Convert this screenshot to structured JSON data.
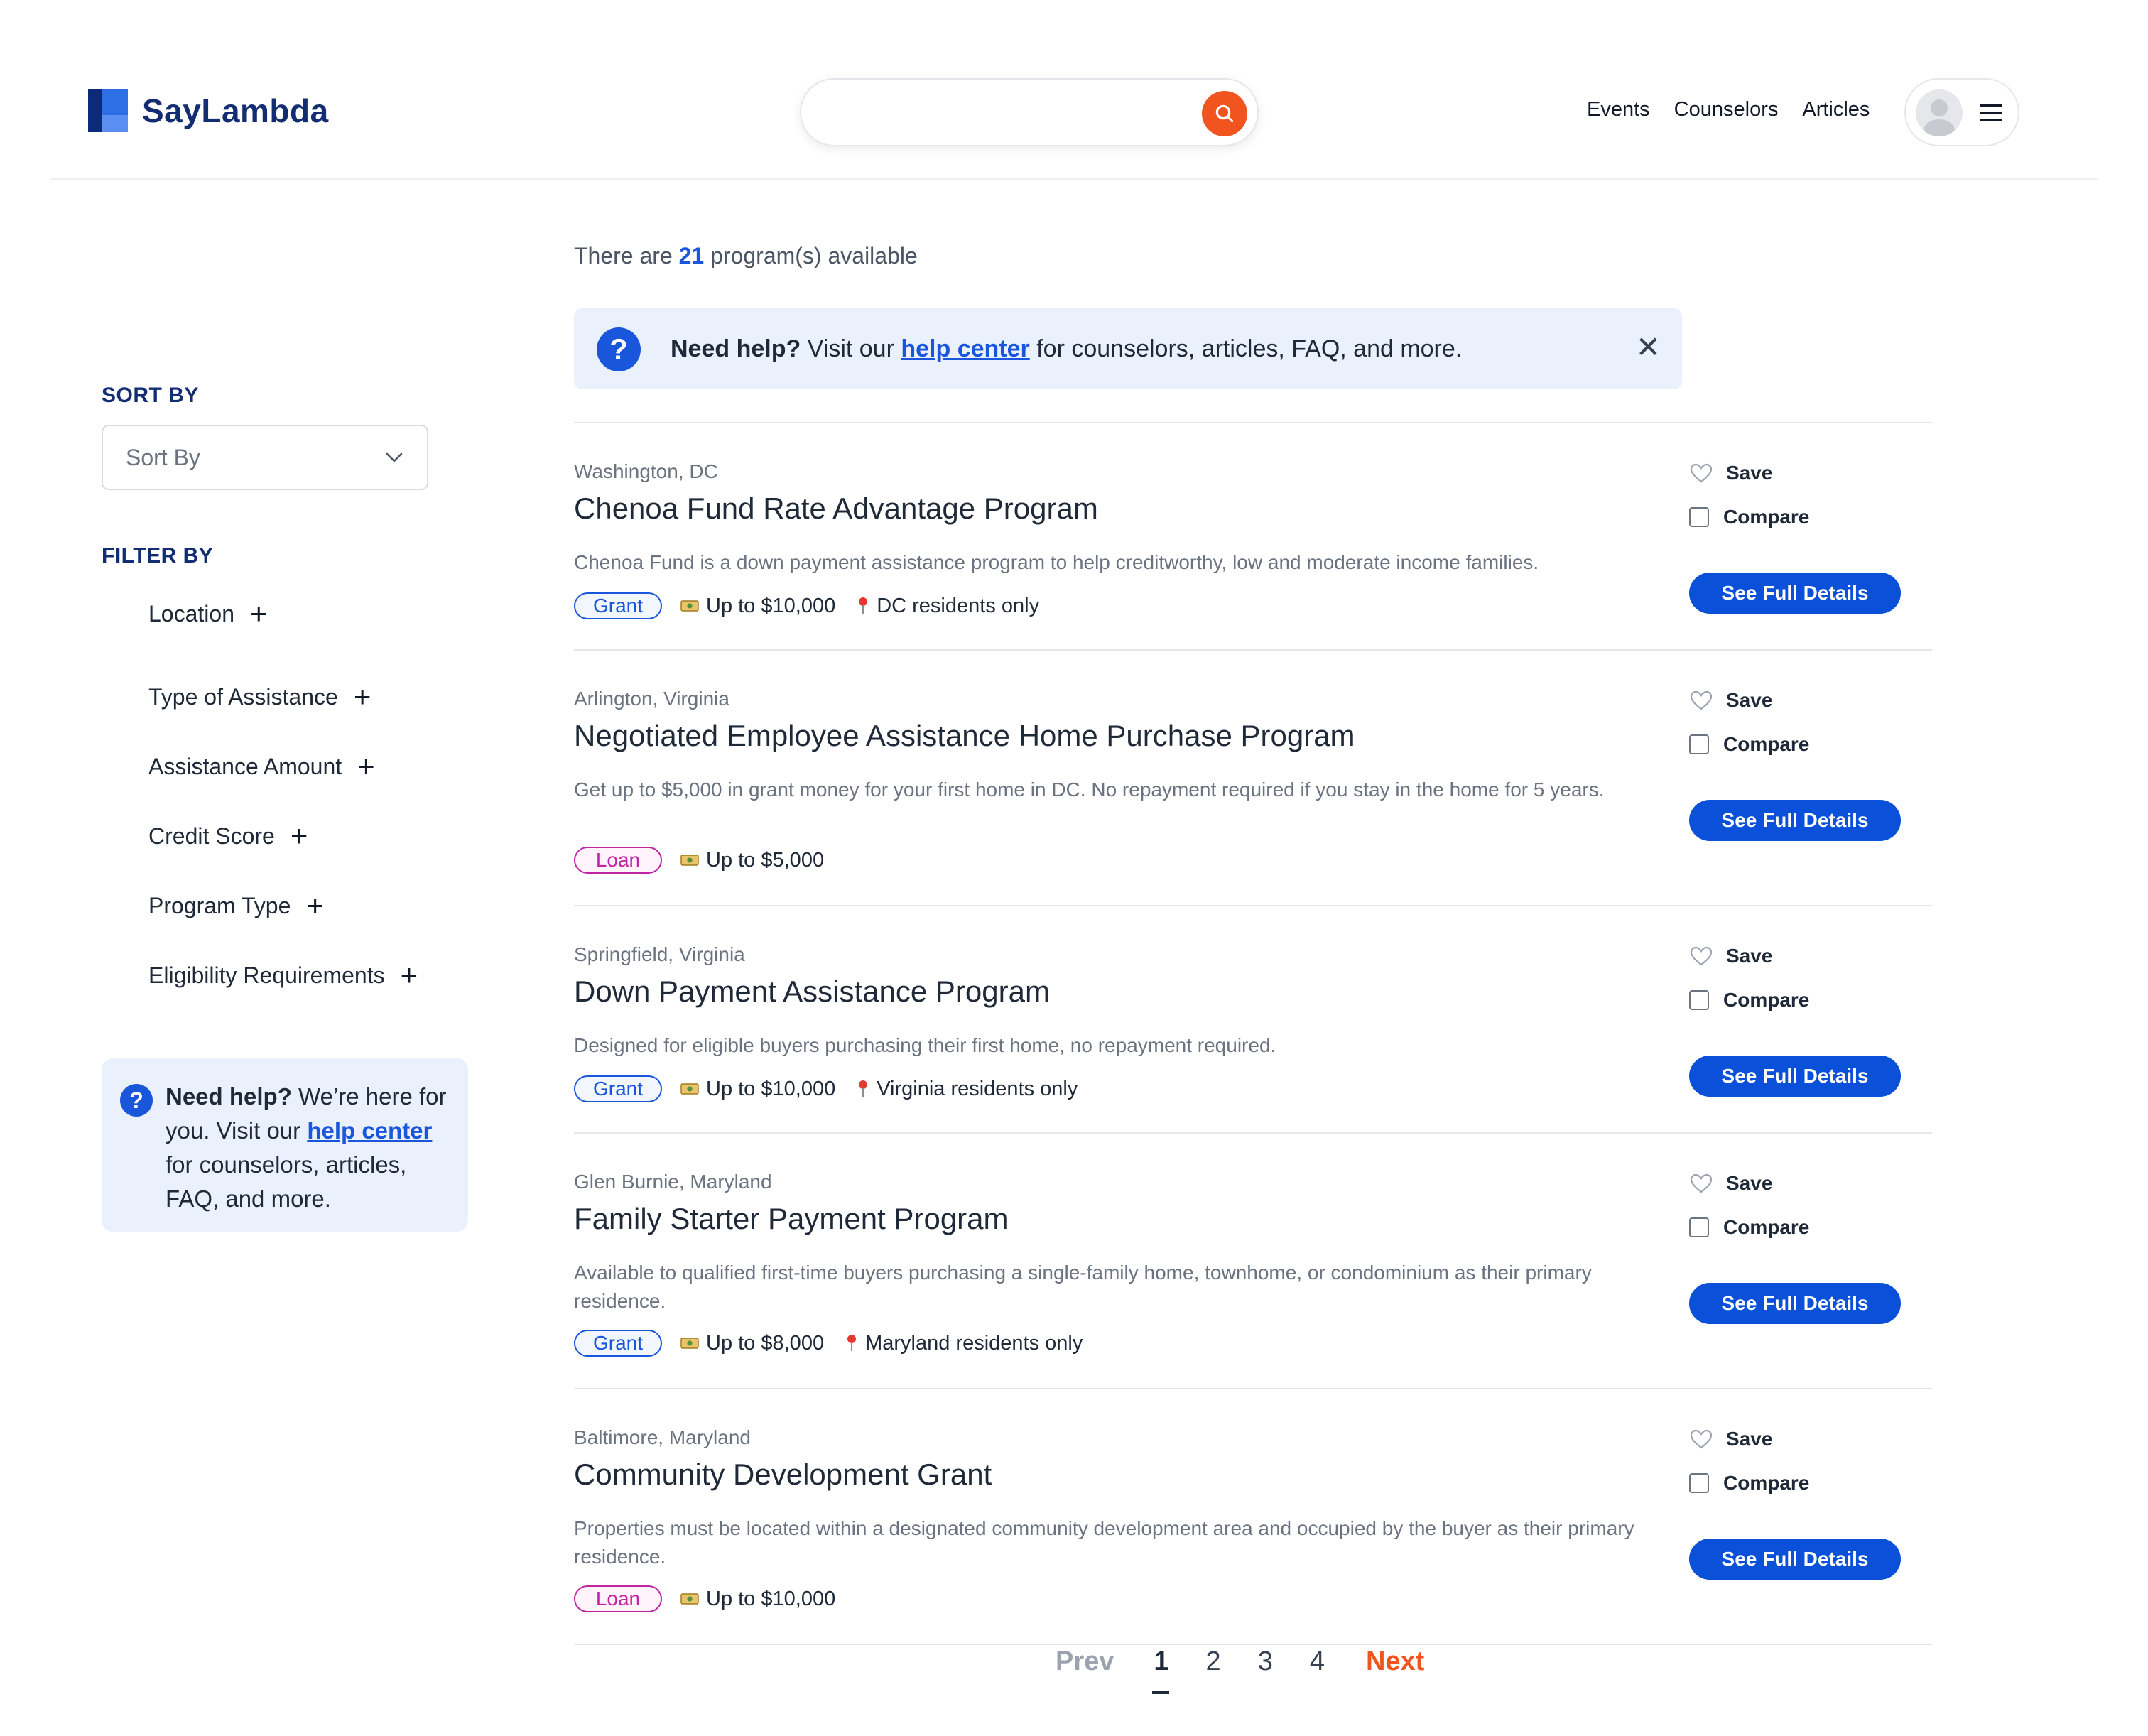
{
  "header": {
    "logo_text": "SayLambda",
    "search": {
      "value": "",
      "placeholder": ""
    },
    "nav": [
      "Events",
      "Counselors",
      "Articles"
    ]
  },
  "summary": {
    "prefix": "There are",
    "count": "21",
    "suffix": "program(s) available"
  },
  "banner": {
    "bold": "Need help?",
    "text_before_link": "Visit our",
    "link": "help center",
    "text_after_link": "for counselors, articles, FAQ, and more."
  },
  "sidebar": {
    "sort_title": "SORT BY",
    "sort_value": "Sort By",
    "filter_title": "FILTER BY",
    "filters": [
      "Location",
      "Type of Assistance",
      "Assistance Amount",
      "Credit Score",
      "Program Type",
      "Eligibility Requirements"
    ],
    "help": {
      "bold": "Need help?",
      "text_before_link": "We’re here for you. Visit our",
      "link": "help center",
      "text_after_link": "for counselors, articles, FAQ, and more."
    }
  },
  "actions": {
    "save": "Save",
    "compare": "Compare",
    "details": "See Full Details"
  },
  "programs": [
    {
      "location": "Washington, DC",
      "title": "Chenoa Fund Rate Advantage Program",
      "description": "Chenoa Fund is a down payment assistance program to help creditworthy, low and moderate income families.",
      "type": "Grant",
      "amount": "Up to $10,000",
      "residency": "DC residents only"
    },
    {
      "location": "Arlington, Virginia",
      "title": "Negotiated Employee Assistance Home Purchase Program",
      "description": "Get up to $5,000 in grant money for your first home in DC. No repayment required if you stay in the home for 5 years.",
      "type": "Loan",
      "amount": "Up to $5,000",
      "residency": ""
    },
    {
      "location": "Springfield, Virginia",
      "title": "Down Payment Assistance Program",
      "description": "Designed for eligible buyers purchasing their first home, no repayment required.",
      "type": "Grant",
      "amount": "Up to $10,000",
      "residency": "Virginia residents only"
    },
    {
      "location": "Glen Burnie, Maryland",
      "title": "Family Starter Payment Program",
      "description": "Available to qualified first-time buyers purchasing a single-family home, townhome, or condominium as their primary residence.",
      "type": "Grant",
      "amount": "Up to $8,000",
      "residency": "Maryland residents only"
    },
    {
      "location": "Baltimore, Maryland",
      "title": "Community Development Grant",
      "description": "Properties must be located within a designated community development area and occupied by the buyer as their primary residence.",
      "type": "Loan",
      "amount": "Up to $10,000",
      "residency": ""
    }
  ],
  "pagination": {
    "prev": "Prev",
    "pages": [
      "1",
      "2",
      "3",
      "4"
    ],
    "current": "1",
    "next": "Next"
  },
  "colors": {
    "brand": "#132d72",
    "primary": "#0b50d8",
    "accent": "#f1541f",
    "loan": "#c026a3"
  },
  "icons": {
    "search": "search-icon",
    "menu": "hamburger-icon",
    "user": "avatar-icon",
    "save": "heart-icon",
    "amount": "money-icon",
    "residency": "pin-icon",
    "close": "close-icon",
    "help": "question-icon"
  }
}
